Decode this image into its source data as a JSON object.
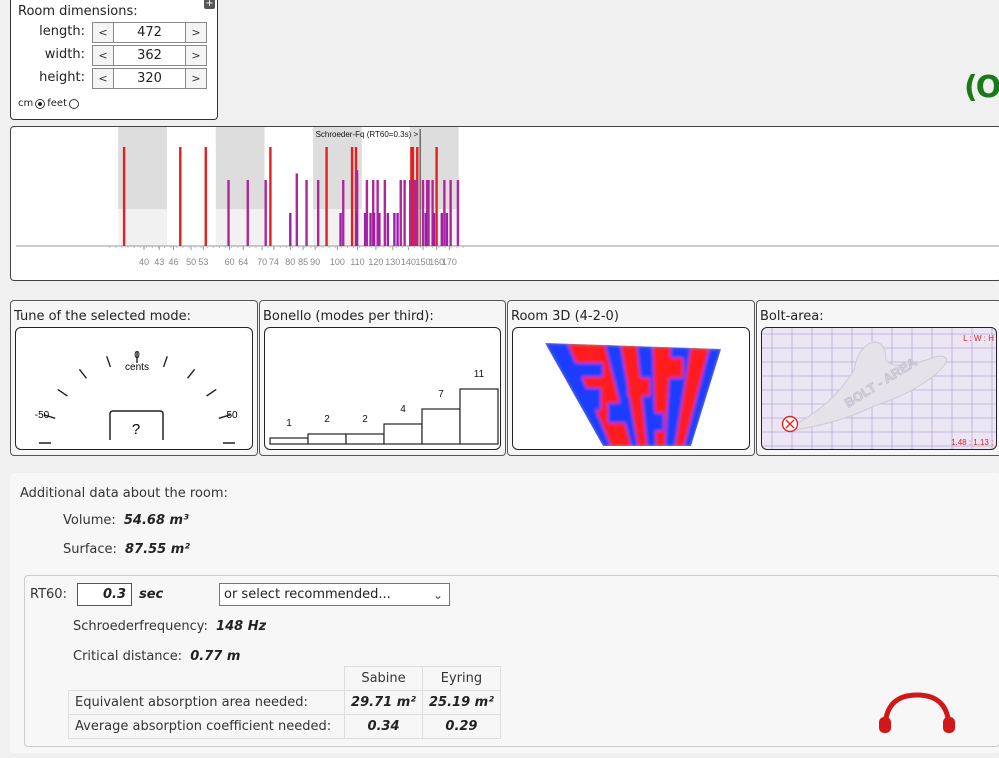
{
  "dims": {
    "title": "Room dimensions:",
    "plus": "+",
    "rows": [
      {
        "label": "length:",
        "value": "472"
      },
      {
        "label": "width:",
        "value": "362"
      },
      {
        "label": "height:",
        "value": "320"
      }
    ],
    "dec": "<",
    "inc": ">",
    "unit_cm": "cm",
    "unit_feet": "feet",
    "selected_unit": "feet"
  },
  "logo_fragment": "(O",
  "modes_chart": {
    "schroeder_label": "Schroeder-Fq (RT60=0.3s) >",
    "ticks": [
      "40",
      "43",
      "46",
      "50",
      "53",
      "60",
      "64",
      "70",
      "74",
      "80",
      "85",
      "90",
      "100",
      "110",
      "120",
      "130",
      "140",
      "150",
      "160",
      "170"
    ]
  },
  "chart_data": {
    "type": "bar",
    "title": "",
    "xlabel": "",
    "ylabel": "",
    "x_scale": "log",
    "schroeder_frequency": 148,
    "series": [
      {
        "name": "",
        "color": "#e61e1e",
        "kind": "axial",
        "points": [
          [
            36.4,
            3
          ],
          [
            47.5,
            3
          ],
          [
            53.6,
            3
          ],
          [
            72.8,
            3
          ],
          [
            95.0,
            3
          ],
          [
            107.2,
            3
          ],
          [
            109.2,
            3
          ],
          [
            142.0,
            3
          ],
          [
            143.0,
            3
          ],
          [
            146.0,
            3
          ],
          [
            160.0,
            3
          ]
        ]
      },
      {
        "name": "",
        "color": "#b0259a",
        "kind": "tangential",
        "points": [
          [
            59.7,
            2
          ],
          [
            65.4,
            2
          ],
          [
            71.2,
            2
          ],
          [
            82.5,
            2.2
          ],
          [
            86.4,
            2
          ],
          [
            91.3,
            2
          ],
          [
            102.8,
            2
          ],
          [
            109.8,
            2.3
          ],
          [
            115.0,
            2
          ],
          [
            118.5,
            2
          ],
          [
            121.0,
            2
          ],
          [
            125.2,
            2
          ],
          [
            135.0,
            2
          ],
          [
            137.5,
            2
          ],
          [
            141.2,
            2
          ],
          [
            144.0,
            2
          ],
          [
            145.0,
            2
          ],
          [
            150.0,
            2
          ],
          [
            153.0,
            2
          ],
          [
            154.0,
            2
          ],
          [
            157.0,
            2
          ],
          [
            166.0,
            2
          ],
          [
            171.0,
            2
          ],
          [
            177.0,
            2
          ]
        ]
      },
      {
        "name": "",
        "color": "#9a1faa",
        "kind": "oblique",
        "points": [
          [
            80.0,
            1
          ],
          [
            101.5,
            1
          ],
          [
            109.5,
            1
          ],
          [
            114.0,
            1
          ],
          [
            117.0,
            1
          ],
          [
            119.0,
            1
          ],
          [
            122.0,
            1
          ],
          [
            127.0,
            1
          ],
          [
            131.0,
            1
          ],
          [
            133.0,
            1
          ],
          [
            152.0,
            1
          ],
          [
            158.0,
            1
          ],
          [
            164.0,
            1
          ],
          [
            168.0,
            1
          ]
        ]
      }
    ]
  },
  "tune": {
    "title": "Tune of the selected mode:",
    "zero": "0",
    "cents": "cents",
    "min": "-50",
    "max": "50",
    "value": "?"
  },
  "bonello": {
    "title": "Bonello (modes per third):",
    "counts": [
      1,
      2,
      2,
      4,
      7,
      11
    ],
    "max": 11
  },
  "room3d": {
    "title": "Room 3D (4-2-0)"
  },
  "bolt": {
    "title": "Bolt-area:",
    "lwh_label": "L : W : H",
    "ratio": "1.48 : 1.13 : 1",
    "watermark": "BOLT - AREA"
  },
  "additional": {
    "heading": "Additional data about the room:",
    "volume_label": "Volume:",
    "volume_value": "54.68 m³",
    "surface_label": "Surface:",
    "surface_value": "87.55 m²",
    "rt60_label": "RT60:",
    "rt60_value": "0.3",
    "rt60_unit": "sec",
    "recommend_placeholder": "or select recommended...",
    "schroeder_label": "Schroederfrequency:",
    "schroeder_value": "148 Hz",
    "critical_label": "Critical distance:",
    "critical_value": "0.77 m",
    "table": {
      "col_sabine": "Sabine",
      "col_eyring": "Eyring",
      "row1_label": "Equivalent absorption area needed:",
      "row1_sabine": "29.71 m²",
      "row1_eyring": "25.19 m²",
      "row2_label": "Average absorption coefficient needed:",
      "row2_sabine": "0.34",
      "row2_eyring": "0.29"
    }
  },
  "colors": {
    "axial": "#e61e1e",
    "tangential": "#b0259a",
    "oblique": "#9a1faa",
    "bonello_stroke": "#222",
    "room_red": "#ff1a1a",
    "room_blue": "#1a3cff",
    "bolt_grid": "#b9a9d3"
  }
}
